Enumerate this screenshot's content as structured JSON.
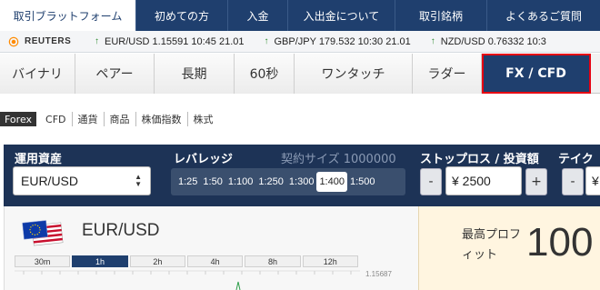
{
  "nav": {
    "items": [
      {
        "label": "取引ブラットフォーム",
        "active": true
      },
      {
        "label": "初めての方",
        "active": false
      },
      {
        "label": "入金",
        "active": false
      },
      {
        "label": "入出金について",
        "active": false
      },
      {
        "label": "取引銘柄",
        "active": false
      },
      {
        "label": "よくあるご質問",
        "active": false
      }
    ]
  },
  "ticker": {
    "brand": "REUTERS",
    "quotes": [
      {
        "text": "EUR/USD 1.15591 10:45 21.01"
      },
      {
        "text": "GBP/JPY 179.532 10:30 21.01"
      },
      {
        "text": "NZD/USD 0.76332 10:3"
      }
    ]
  },
  "tabs": [
    {
      "label": "バイナリ"
    },
    {
      "label": "ペアー"
    },
    {
      "label": "長期"
    },
    {
      "label": "60秒"
    },
    {
      "label": "ワンタッチ"
    },
    {
      "label": "ラダー"
    },
    {
      "label": "FX / CFD"
    }
  ],
  "filters": [
    {
      "label": "Forex"
    },
    {
      "label": "CFD"
    },
    {
      "label": "通貨"
    },
    {
      "label": "商品"
    },
    {
      "label": "株価指数"
    },
    {
      "label": "株式"
    }
  ],
  "panel": {
    "asset_label": "運用資産",
    "asset_value": "EUR/USD",
    "leverage_label": "レバレッジ",
    "contract_size": "契約サイズ 1000000",
    "leverage_options": [
      "1:25",
      "1:50",
      "1:100",
      "1:250",
      "1:300",
      "1:400",
      "1:500"
    ],
    "leverage_selected": "1:400",
    "stoploss_label": "ストップロス / 投資額",
    "stoploss_minus": "-",
    "stoploss_value": "¥ 2500",
    "stoploss_plus": "+",
    "takeprofit_label": "テイク",
    "takeprofit_minus": "-",
    "takeprofit_value": "¥"
  },
  "instrument": {
    "title": "EUR/USD",
    "timeframes": [
      "30m",
      "1h",
      "2h",
      "4h",
      "8h",
      "12h"
    ],
    "timeframe_selected": "1h",
    "price_label": "1.15687"
  },
  "profit": {
    "label": "最高プロフィット",
    "value": "100"
  }
}
